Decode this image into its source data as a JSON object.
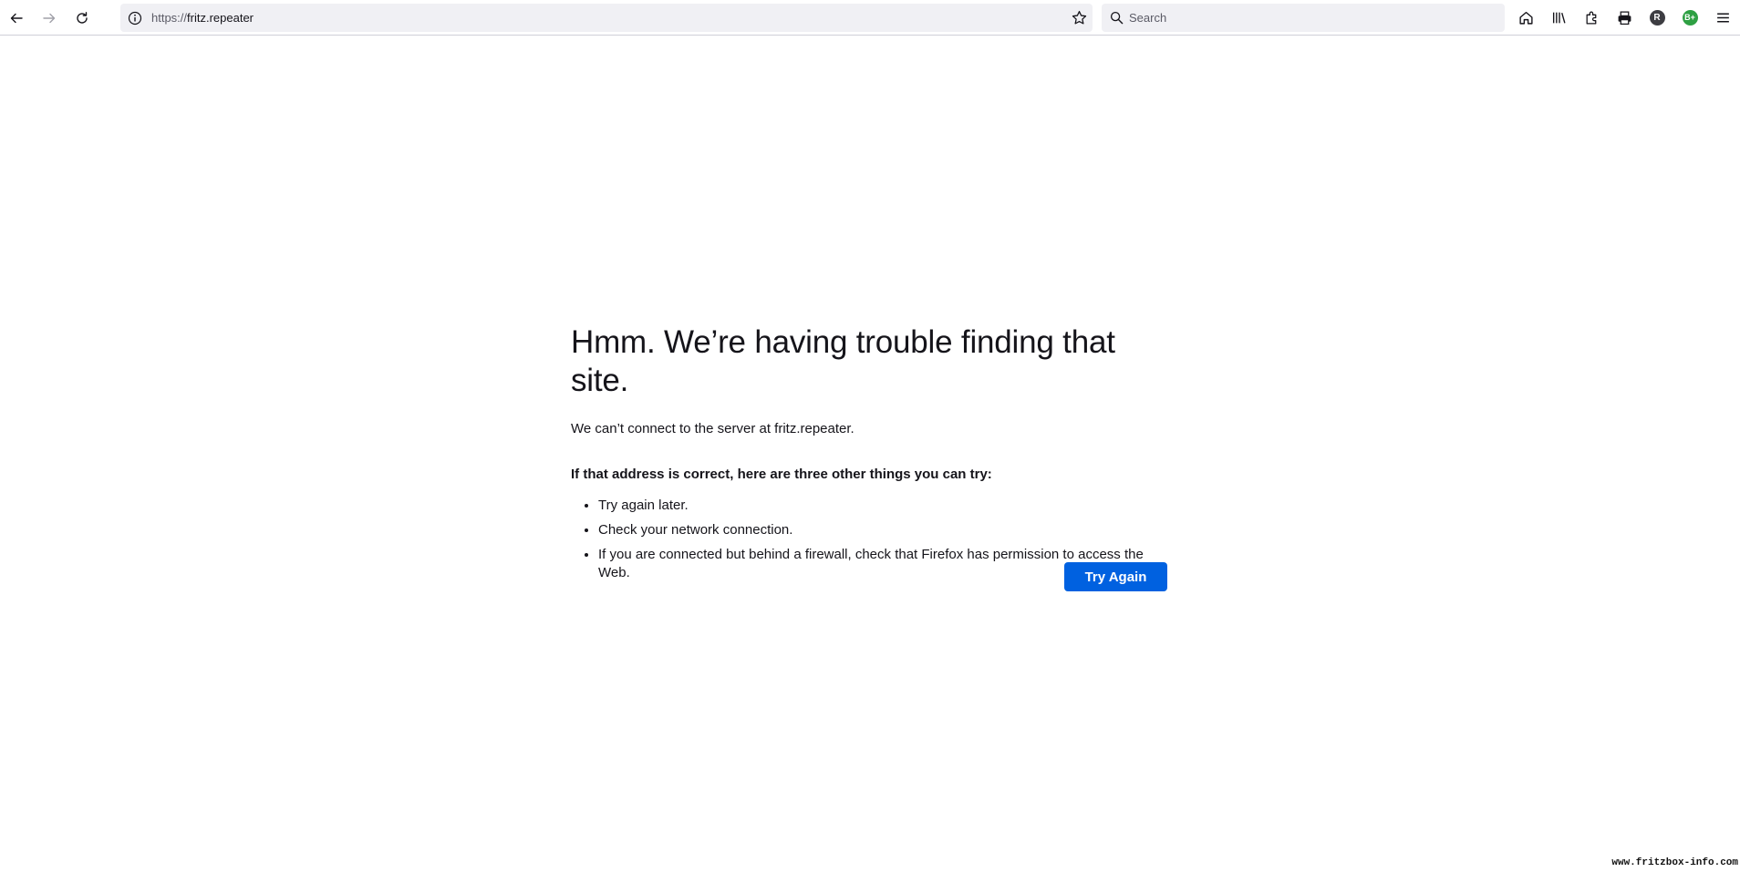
{
  "browser": {
    "url_scheme": "https://",
    "url_host": "fritz.repeater",
    "search_placeholder": "Search",
    "avatar_r": "R",
    "avatar_b": "B+"
  },
  "error_page": {
    "title": "Hmm. We’re having trouble finding that site.",
    "description": "We can’t connect to the server at fritz.repeater.",
    "advice_heading": "If that address is correct, here are three other things you can try:",
    "advice_items": [
      "Try again later.",
      "Check your network connection.",
      "If you are connected but behind a firewall, check that Firefox has permission to access the Web."
    ],
    "try_again_label": "Try Again",
    "button_color": "#0061e0"
  },
  "watermark": "www.fritzbox-info.com"
}
